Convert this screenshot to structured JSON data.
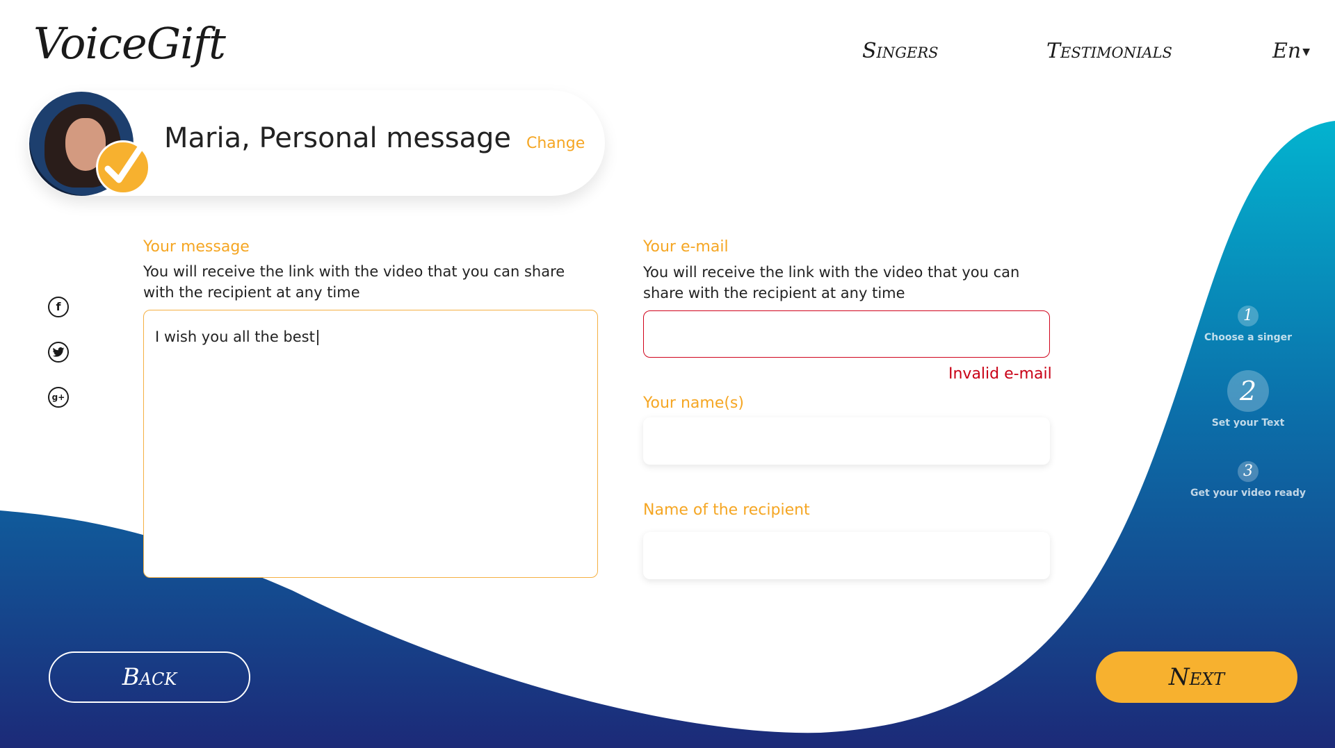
{
  "brand": {
    "logo_text": "VoiceGift"
  },
  "nav": {
    "singers": "Singers",
    "testimonials": "Testimonials",
    "language": "En"
  },
  "summary": {
    "title": "Maria, Personal message",
    "change": "Change"
  },
  "message": {
    "label": "Your message",
    "helper_line1": "You will receive the link with the video that you can share",
    "helper_line2": "with the recipient at any time",
    "value": "I wish you all the best"
  },
  "email": {
    "label": "Your e-mail",
    "helper_line1": "You will receive the link with the video that you can",
    "helper_line2": "share with the recipient at any time",
    "value": "",
    "error": "Invalid e-mail"
  },
  "names": {
    "label": "Your name(s)",
    "value": ""
  },
  "recipient": {
    "label": "Name of the recipient",
    "value": ""
  },
  "steps": [
    {
      "number": "1",
      "label": "Choose a singer"
    },
    {
      "number": "2",
      "label": "Set your Text"
    },
    {
      "number": "3",
      "label": "Get your video ready"
    }
  ],
  "current_step": 2,
  "buttons": {
    "back": "Back",
    "next": "Next"
  },
  "social_icons": [
    "facebook-icon",
    "twitter-icon",
    "google-plus-icon"
  ],
  "colors": {
    "accent": "#f5a623",
    "button_next": "#f7b12f",
    "error": "#c90016",
    "wave_top": "#03b3cf",
    "wave_bottom": "#1c2a78"
  }
}
